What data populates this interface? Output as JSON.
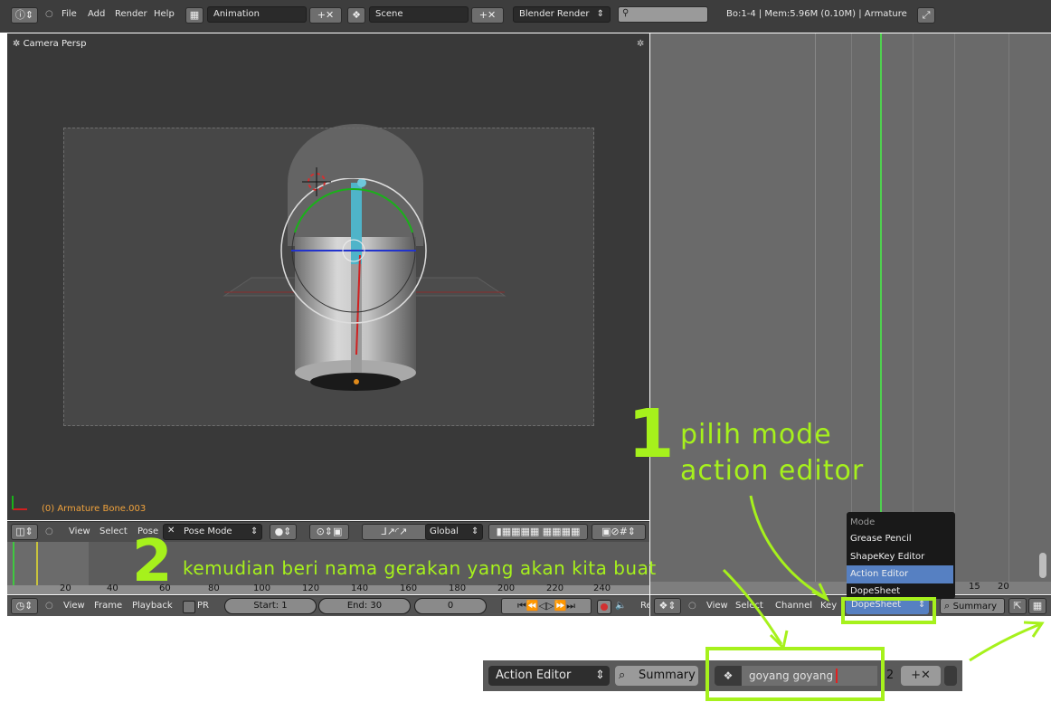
{
  "topbar": {
    "menus": [
      "File",
      "Add",
      "Render",
      "Help"
    ],
    "screen_layout": "Animation",
    "scene": "Scene",
    "render_engine": "Blender Render",
    "stats": "Bo:1-4  | Mem:5.96M (0.10M) | Armature"
  },
  "viewport": {
    "view_name": "Camera Persp",
    "object_info": "(0) Armature Bone.003",
    "header": {
      "menus": [
        "View",
        "Select",
        "Pose"
      ],
      "mode": "Pose Mode",
      "orientation": "Global"
    }
  },
  "timeline": {
    "ruler": [
      "20",
      "40",
      "60",
      "80",
      "100",
      "120",
      "140",
      "160",
      "180",
      "200",
      "220",
      "240"
    ],
    "menus": [
      "View",
      "Frame",
      "Playback"
    ],
    "pr_label": "PR",
    "start": "Start: 1",
    "end": "End: 30",
    "current": "0",
    "trailing": "Re"
  },
  "dopesheet": {
    "ruler": [
      "15",
      "20"
    ],
    "menus": [
      "View",
      "Select",
      "Channel",
      "Key"
    ],
    "mode": "DopeSheet",
    "summary": "Summary"
  },
  "mode_menu": {
    "title": "Mode",
    "items": [
      "Grease Pencil",
      "ShapeKey Editor",
      "Action Editor",
      "DopeSheet"
    ],
    "selected": "Action Editor"
  },
  "bottom_strip": {
    "mode": "Action Editor",
    "summary": "Summary",
    "action_name": "goyang goyang",
    "users": "2"
  },
  "annotations": {
    "step1_number": "1",
    "step1_line1": "pilih mode",
    "step1_line2": "action editor",
    "step2_number": "2",
    "step2_text": "kemudian beri nama gerakan yang akan kita buat"
  },
  "colors": {
    "annotation": "#a6f11c",
    "selection": "#5680c2",
    "cursor": "#e32121"
  }
}
